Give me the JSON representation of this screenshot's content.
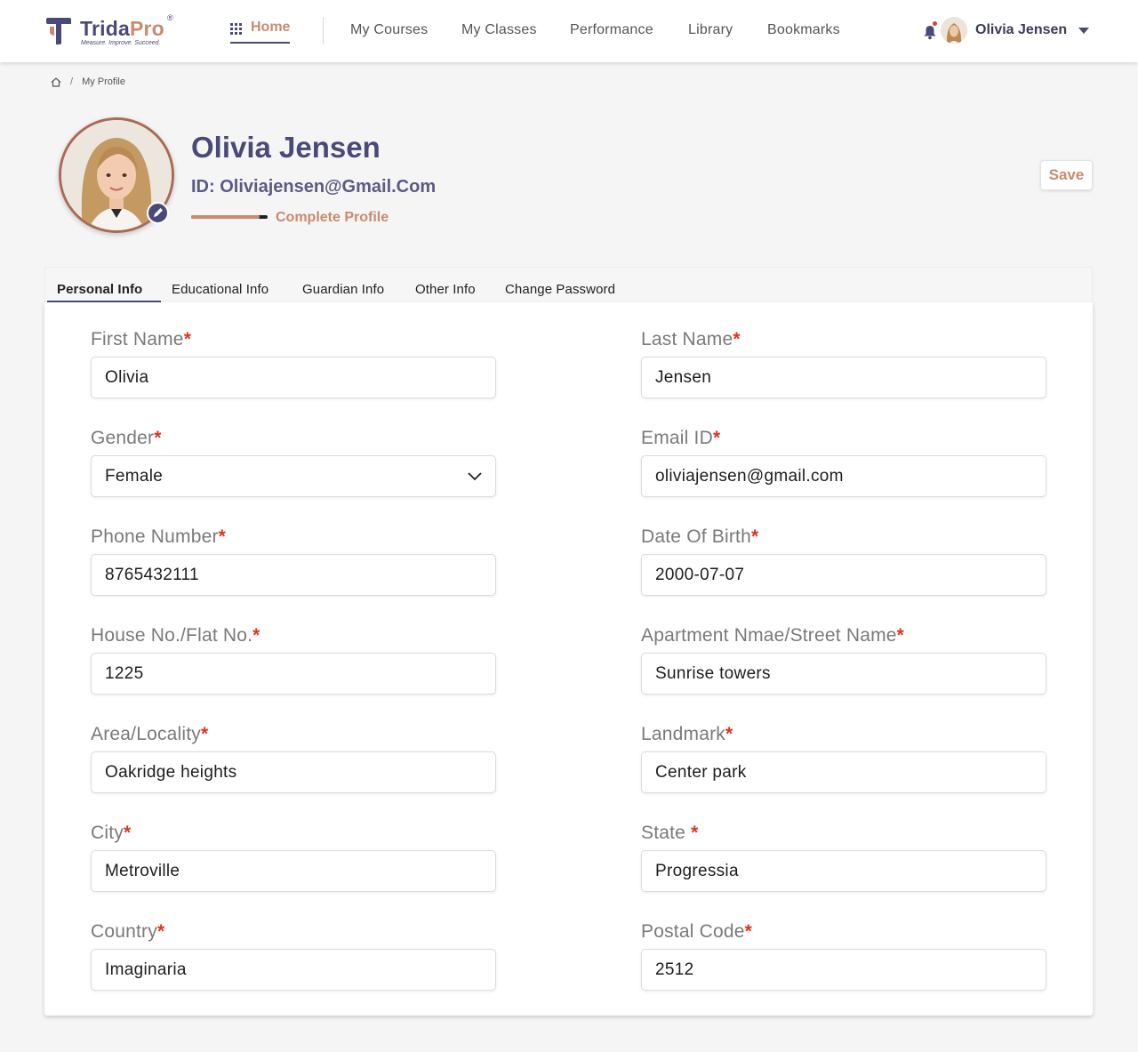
{
  "brand": {
    "name_main": "Trida",
    "name_accent": "Pro",
    "registered_mark": "®",
    "tagline": "Measure. Improve. Succeed."
  },
  "nav": {
    "home": "Home",
    "links": [
      "My Courses",
      "My Classes",
      "Performance",
      "Library",
      "Bookmarks"
    ],
    "user_name": "Olivia Jensen"
  },
  "breadcrumb": {
    "separator": "/",
    "current": "My Profile"
  },
  "profile": {
    "name": "Olivia Jensen",
    "id_text": "ID: Oliviajensen@Gmail.Com",
    "complete_link": "Complete Profile",
    "profile_completion": 0.9,
    "save_label": "Save"
  },
  "tabs": [
    "Personal Info",
    "Educational Info",
    "Guardian Info",
    "Other Info",
    "Change Password"
  ],
  "form": {
    "required_mark": "*",
    "fields": {
      "first_name": {
        "label": "First Name",
        "value": "Olivia"
      },
      "last_name": {
        "label": "Last Name",
        "value": "Jensen"
      },
      "gender": {
        "label": "Gender",
        "value": "Female"
      },
      "email": {
        "label": "Email ID",
        "value": "oliviajensen@gmail.com"
      },
      "phone": {
        "label": "Phone Number",
        "value": "8765432111"
      },
      "dob": {
        "label": "Date Of Birth",
        "value": "2000-07-07"
      },
      "house": {
        "label": "House No./Flat No.",
        "value": "1225"
      },
      "street": {
        "label": "Apartment Nmae/Street Name",
        "value": "Sunrise towers"
      },
      "area": {
        "label": "Area/Locality",
        "value": "Oakridge heights"
      },
      "landmark": {
        "label": "Landmark",
        "value": "Center park"
      },
      "city": {
        "label": "City",
        "value": "Metroville"
      },
      "state": {
        "label": "State ",
        "value": "Progressia"
      },
      "country": {
        "label": "Country",
        "value": "Imaginaria"
      },
      "postal": {
        "label": "Postal Code",
        "value": "2512"
      }
    }
  },
  "icons": {
    "nav_home": "grid-icon",
    "notifications": "bell-icon",
    "user_menu": "caret-down-icon",
    "breadcrumb_home": "home-icon",
    "edit_photo": "pencil-icon",
    "select": "chevron-down-icon"
  },
  "colors": {
    "primary": "#4a4a7a",
    "accent": "#c98a6e",
    "required": "#e0341e",
    "notification_dot": "#e53935"
  }
}
